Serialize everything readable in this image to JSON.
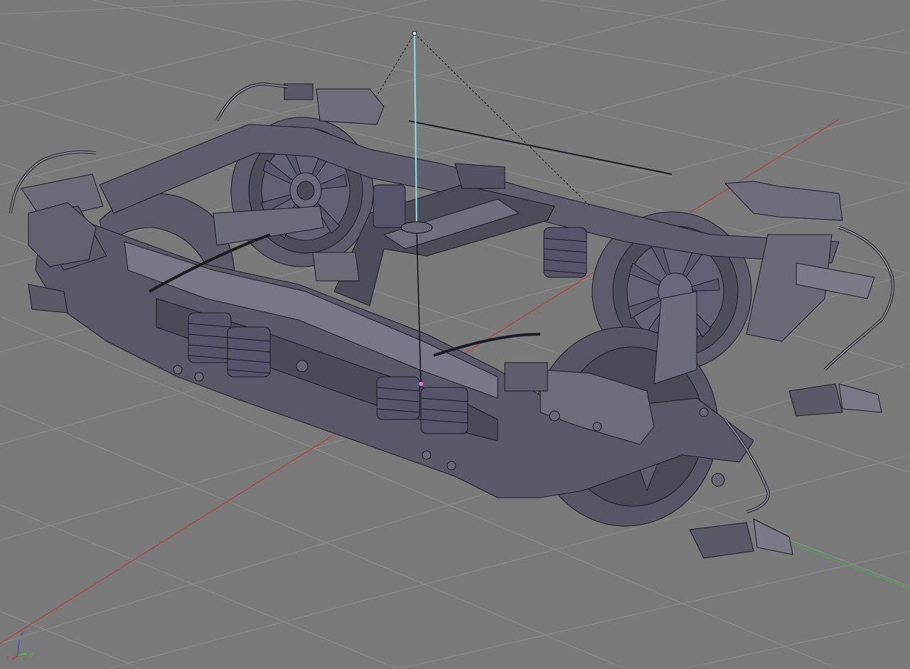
{
  "viewport": {
    "background": "#7a7a7a",
    "grid_color": "#8a8a8a",
    "x_axis_color": "#b8413f",
    "y_axis_color": "#3fae46",
    "wireframe_color": "#1c1c24",
    "solid_fill": "#5b5a6a",
    "light_fill": "#6b6a78",
    "selection_color": "#7fe6e6",
    "selected_vertex_color": "#e070e0"
  },
  "axis_gizmo": {
    "x_label": "x",
    "y_label": "y",
    "z_label": "z",
    "x_color": "#d23a3a",
    "y_color": "#3ac23a",
    "z_color": "#3a5ad2"
  },
  "scene": {
    "object": "bogie-wireframe-model",
    "shading": "solid-with-wire"
  }
}
